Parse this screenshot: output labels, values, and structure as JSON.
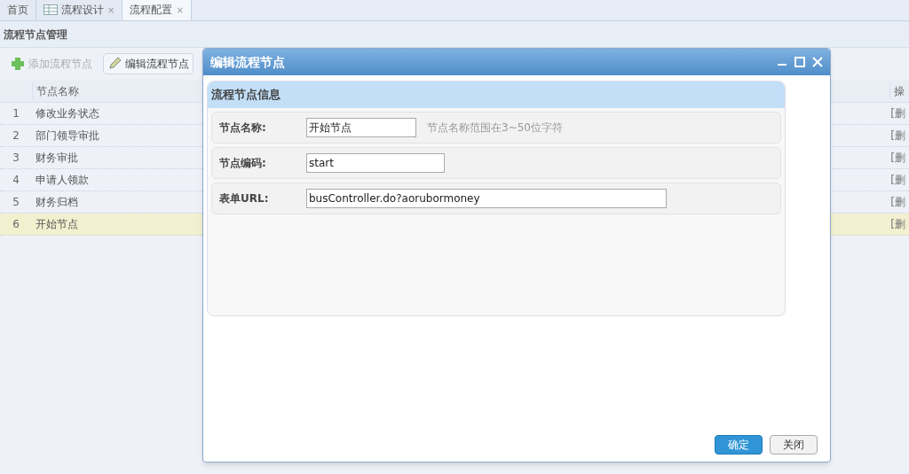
{
  "tabs": [
    {
      "label": "首页",
      "icon": false,
      "closable": false,
      "selected": false
    },
    {
      "label": "流程设计",
      "icon": true,
      "closable": true,
      "selected": false
    },
    {
      "label": "流程配置",
      "icon": false,
      "closable": true,
      "selected": true
    }
  ],
  "close_mark": "×",
  "panel": {
    "title": "流程节点管理"
  },
  "toolbar": [
    {
      "label": "添加流程节点",
      "kind": "add",
      "disabled": true
    },
    {
      "label": "编辑流程节点",
      "kind": "edit",
      "disabled": false
    }
  ],
  "table": {
    "columns": [
      "节点名称",
      "操"
    ],
    "rows": [
      {
        "index": "1",
        "name": "修改业务状态",
        "action": "[删",
        "selected": false
      },
      {
        "index": "2",
        "name": "部门领导审批",
        "action": "[删",
        "selected": false
      },
      {
        "index": "3",
        "name": "财务审批",
        "action": "[删",
        "selected": false
      },
      {
        "index": "4",
        "name": "申请人领款",
        "action": "[删",
        "selected": false
      },
      {
        "index": "5",
        "name": "财务归档",
        "action": "[删",
        "selected": false
      },
      {
        "index": "6",
        "name": "开始节点",
        "action": "[删",
        "selected": true
      }
    ]
  },
  "dialog": {
    "title": "编辑流程节点",
    "section": "流程节点信息",
    "fields": [
      {
        "label": "节点名称:",
        "value": "开始节点",
        "hint": "节点名称范围在3~50位字符"
      },
      {
        "label": "节点编码:",
        "value": "start"
      },
      {
        "label": "表单URL:",
        "value": "busController.do?aorubormoney"
      }
    ],
    "buttons": [
      {
        "label": "确定",
        "primary": true
      },
      {
        "label": "关闭",
        "primary": false
      }
    ]
  }
}
